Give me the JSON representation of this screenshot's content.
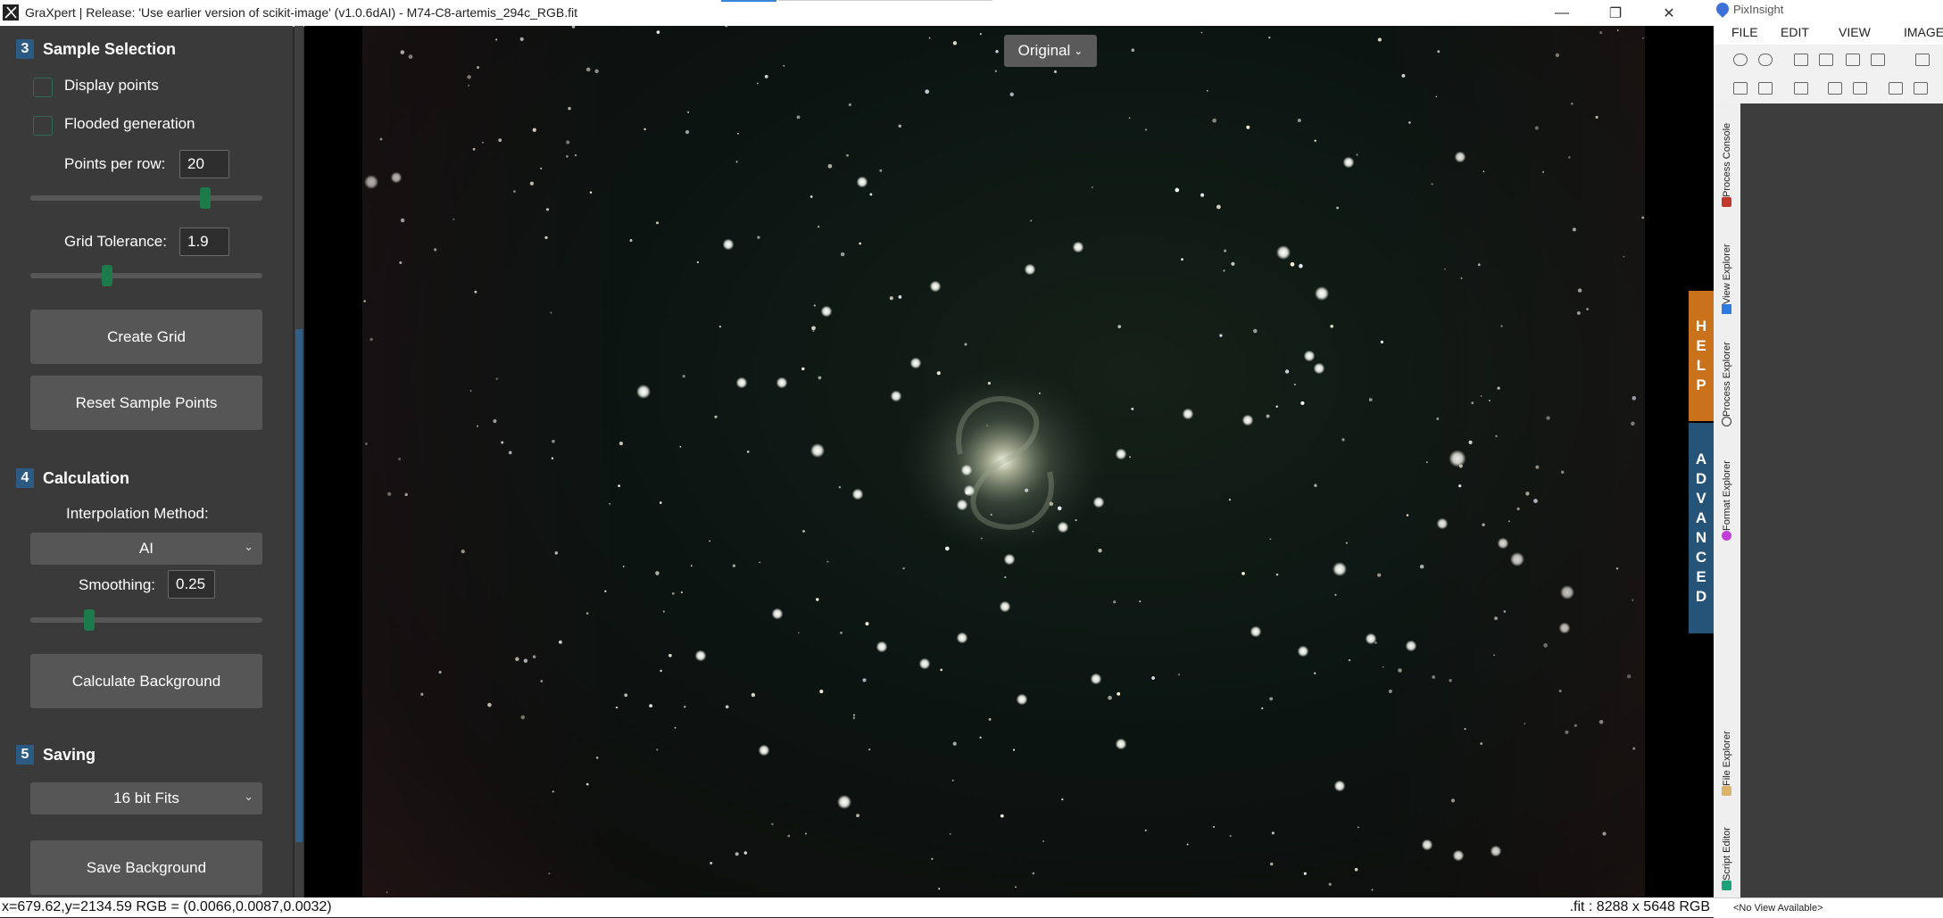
{
  "graxpert": {
    "window_title": "GraXpert | Release: 'Use earlier version of scikit-image' (v1.0.6dAI) - M74-C8-artemis_294c_RGB.fit",
    "sections": {
      "sample_selection": {
        "number": "3",
        "title": "Sample Selection",
        "display_points": "Display points",
        "display_points_checked": false,
        "flooded_generation": "Flooded generation",
        "flooded_generation_checked": false,
        "points_per_row_label": "Points per row:",
        "points_per_row_value": "20",
        "points_per_row_slider": 0.7,
        "grid_tolerance_label": "Grid Tolerance:",
        "grid_tolerance_value": "1.9",
        "grid_tolerance_slider": 0.31,
        "create_grid": "Create Grid",
        "reset_sample_points": "Reset Sample Points"
      },
      "calculation": {
        "number": "4",
        "title": "Calculation",
        "interpolation_label": "Interpolation Method:",
        "interpolation_value": "AI",
        "smoothing_label": "Smoothing:",
        "smoothing_value": "0.25",
        "smoothing_slider": 0.25,
        "calculate_background": "Calculate Background"
      },
      "saving": {
        "number": "5",
        "title": "Saving",
        "format_value": "16 bit Fits",
        "save_background": "Save Background"
      }
    },
    "view_dropdown": "Original",
    "help_tab": "HELP",
    "advanced_tab": "ADVANCED",
    "status_left": "x=679.62,y=2134.59  RGB = (0.0066,0.0087,0.0032)",
    "status_right": ".fit : 8288 x 5648 RGB"
  },
  "pixinsight": {
    "title": "PixInsight",
    "menu": [
      "FILE",
      "EDIT",
      "VIEW",
      "IMAGE"
    ],
    "side_tabs": {
      "process_console": "Process Console",
      "view_explorer": "View Explorer",
      "process_explorer": "Process Explorer",
      "format_explorer": "Format Explorer",
      "file_explorer": "File Explorer",
      "script_editor": "Script Editor"
    },
    "status": "<No View Available>"
  },
  "colors": {
    "accent_blue": "#2b5a82",
    "slider_knob": "#1d7a4a",
    "help_orange": "#c9721b",
    "advanced_blue": "#265478"
  }
}
